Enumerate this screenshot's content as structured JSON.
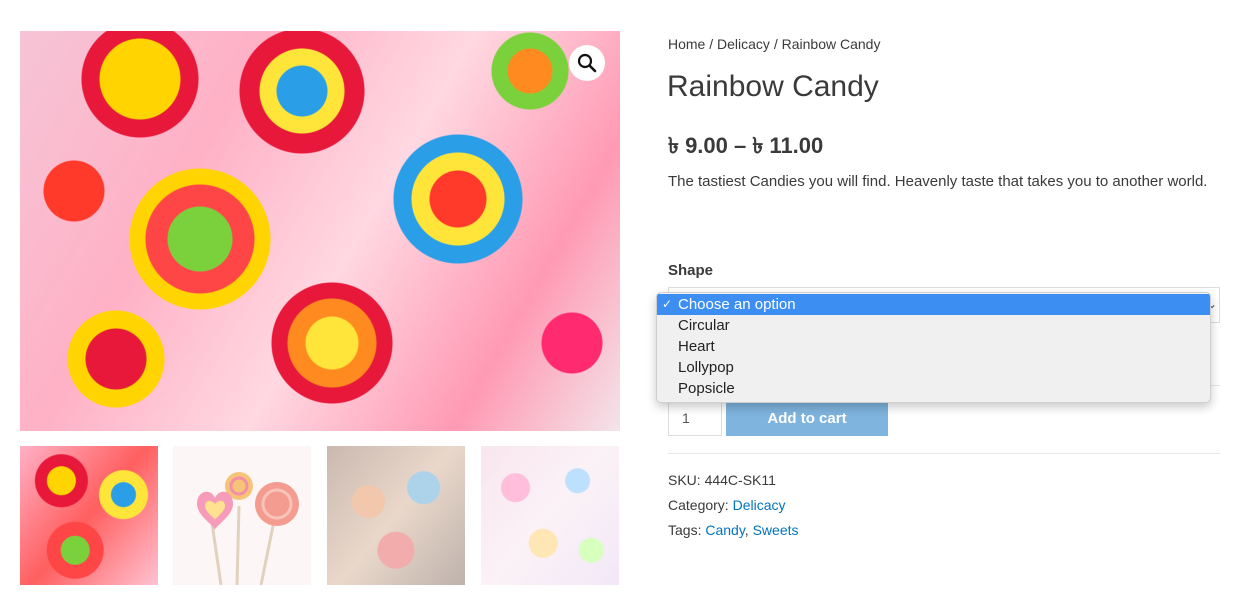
{
  "breadcrumb": {
    "home": "Home",
    "sep1": " / ",
    "category": "Delicacy",
    "sep2": " / ",
    "current": "Rainbow Candy"
  },
  "product": {
    "title": "Rainbow Candy",
    "price": "৳ 9.00 – ৳ 11.00",
    "description": "The tastiest Candies you will find. Heavenly taste that takes you to another world."
  },
  "variation": {
    "label": "Shape",
    "options": [
      {
        "label": "Choose an option",
        "selected": true
      },
      {
        "label": "Circular",
        "selected": false
      },
      {
        "label": "Heart",
        "selected": false
      },
      {
        "label": "Lollypop",
        "selected": false
      },
      {
        "label": "Popsicle",
        "selected": false
      }
    ],
    "check_mark": "✓"
  },
  "cart": {
    "quantity": "1",
    "add_label": "Add to cart"
  },
  "meta": {
    "sku_label": "SKU: ",
    "sku": "444C-SK11",
    "category_label": "Category: ",
    "category": "Delicacy",
    "tags_label": "Tags: ",
    "tag1": "Candy",
    "tag_sep": ", ",
    "tag2": "Sweets"
  },
  "icons": {
    "zoom": "magnifier-icon",
    "select_arrow": "chevron-down-icon"
  },
  "colors": {
    "accent": "#7eb4dd",
    "link": "#0274be",
    "selection": "#3d8ef3"
  }
}
